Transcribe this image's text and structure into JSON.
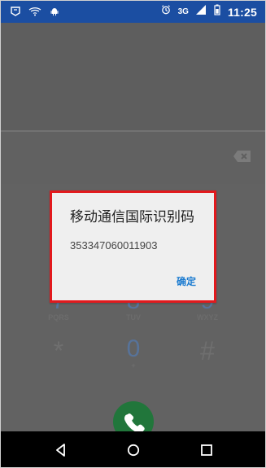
{
  "status_bar": {
    "network_label": "3G",
    "time": "11:25",
    "icons": [
      "notification-icon",
      "wifi-question-icon",
      "android-icon",
      "alarm-icon",
      "signal-icon",
      "battery-icon"
    ]
  },
  "dialer": {
    "keys": [
      {
        "digit": "7",
        "letters": "PQRS"
      },
      {
        "digit": "8",
        "letters": "TUV"
      },
      {
        "digit": "9",
        "letters": "WXYZ"
      },
      {
        "digit": "*",
        "letters": ""
      },
      {
        "digit": "0",
        "letters": "+"
      },
      {
        "digit": "#",
        "letters": ""
      }
    ],
    "icons": {
      "backspace": "backspace-icon",
      "call": "phone-icon"
    }
  },
  "dialog": {
    "title": "移动通信国际识别码",
    "body": "353347060011903",
    "action": "确定"
  },
  "navigation": {
    "icons": [
      "back-icon",
      "home-icon",
      "recents-icon"
    ]
  },
  "colors": {
    "status_bar": "#1b4ea2",
    "dialog_border": "#e2191d",
    "dialog_action": "#1b7bd0",
    "call_button": "#21763b"
  }
}
